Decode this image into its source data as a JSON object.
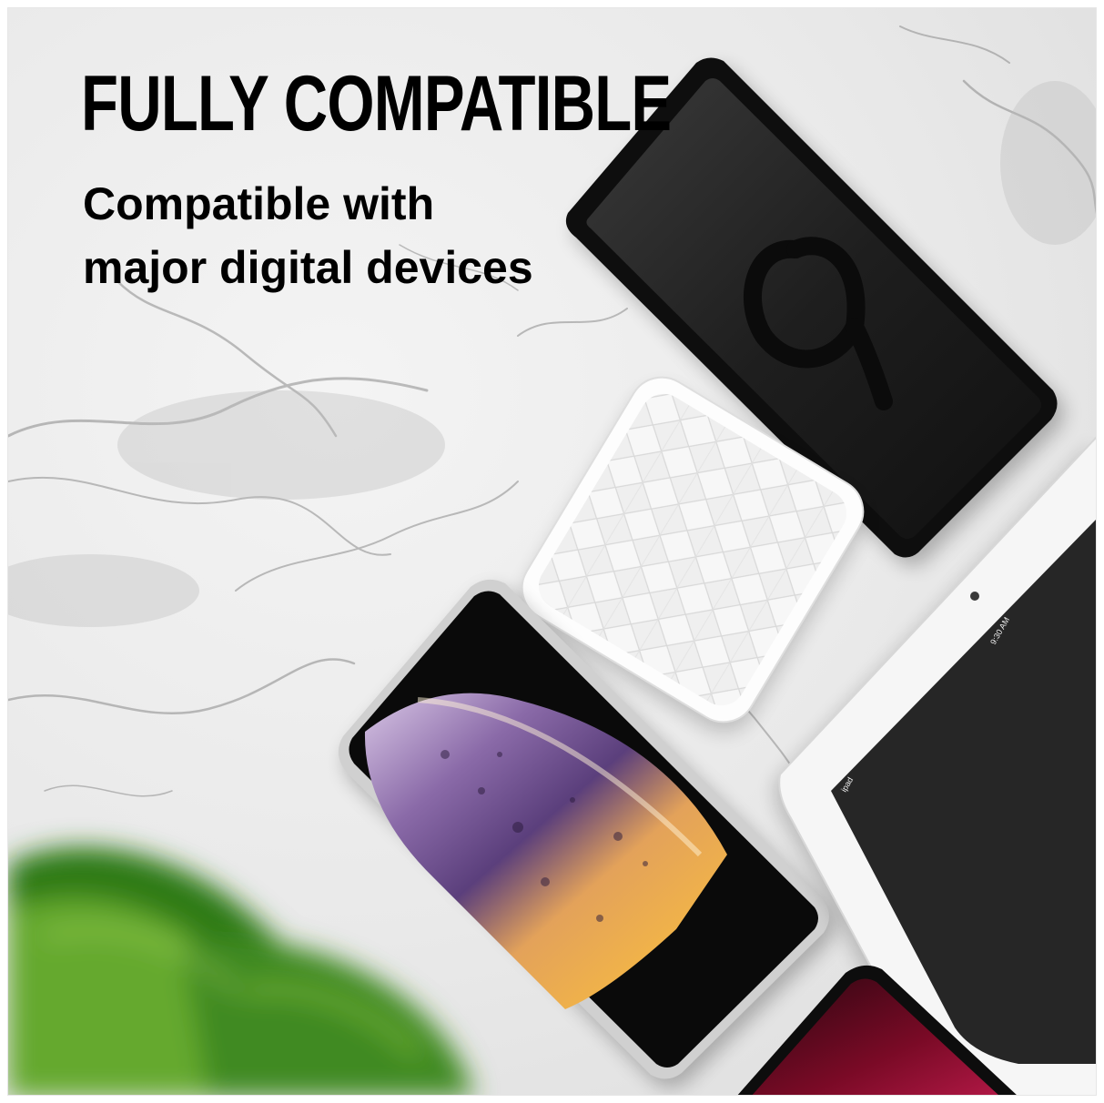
{
  "headline": "FULLY COMPATIBLE",
  "subhead": {
    "line1": "Compatible with",
    "line2": "major digital devices"
  },
  "devices": {
    "android_screen_numeral": "9",
    "tablet_time": "9:30 AM",
    "tablet_label": "ipad"
  },
  "colors": {
    "text": "#000000",
    "marble": "#ececec",
    "phone_body": "#111111",
    "leaf": "#3f8a21",
    "accent_red": "#7a0a26"
  }
}
